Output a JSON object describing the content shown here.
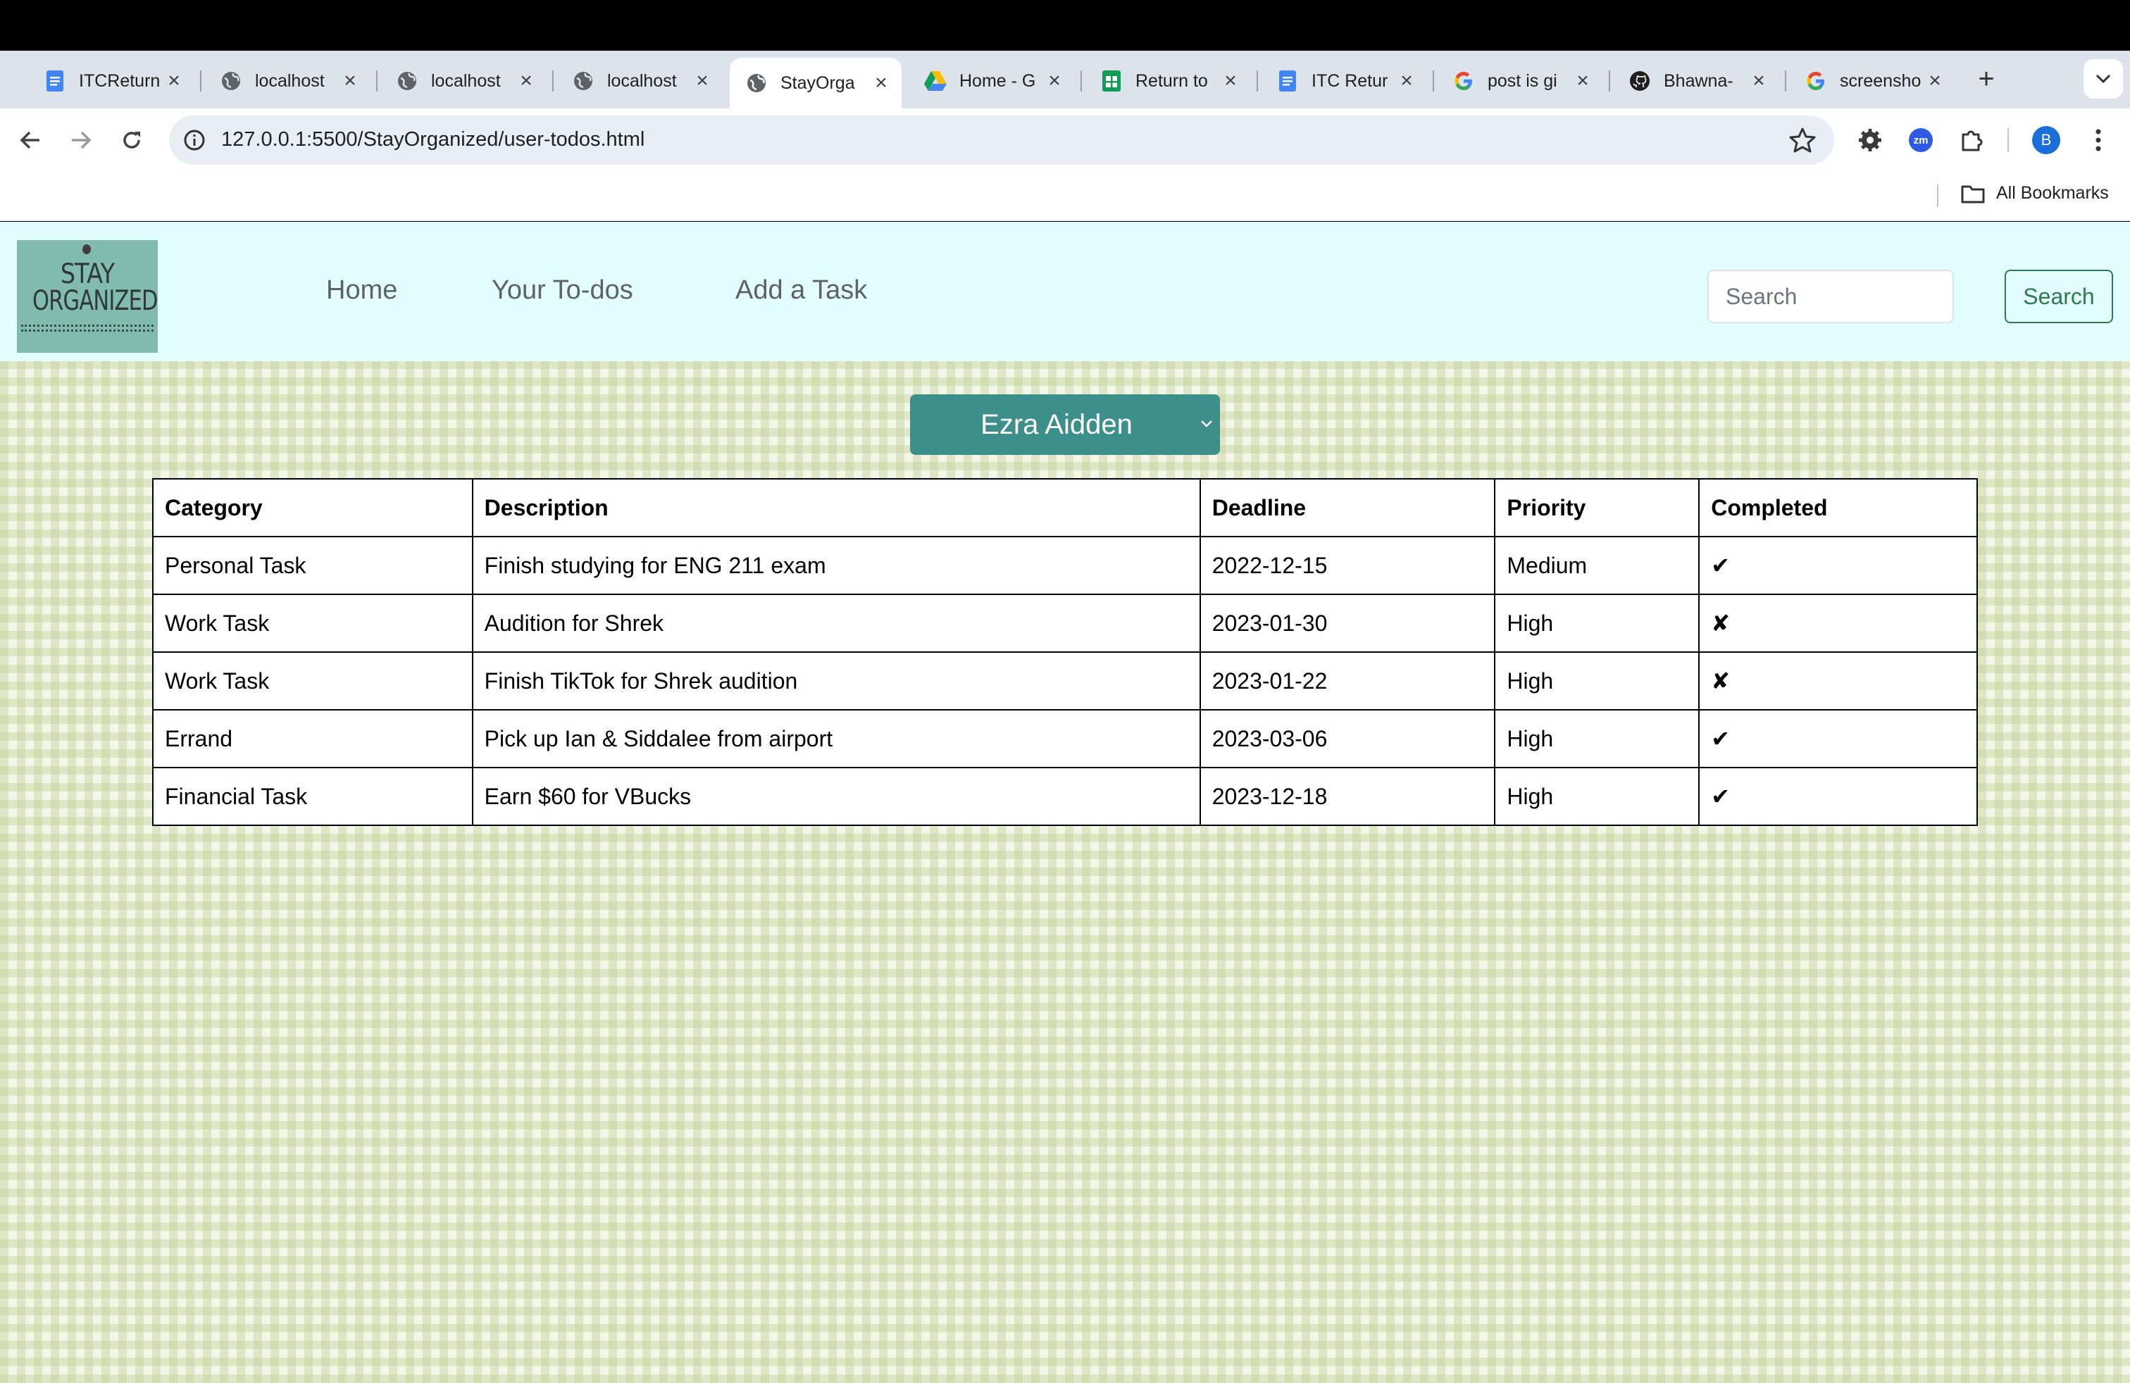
{
  "browser": {
    "tabs": [
      {
        "title": "ITCReturn",
        "icon": "google-docs-icon",
        "active": false
      },
      {
        "title": "localhost",
        "icon": "globe-icon",
        "active": false
      },
      {
        "title": "localhost",
        "icon": "globe-icon",
        "active": false
      },
      {
        "title": "localhost",
        "icon": "globe-icon",
        "active": false
      },
      {
        "title": "StayOrga",
        "icon": "globe-icon",
        "active": true
      },
      {
        "title": "Home - G",
        "icon": "google-drive-icon",
        "active": false
      },
      {
        "title": "Return to",
        "icon": "google-sheets-icon",
        "active": false
      },
      {
        "title": "ITC Retur",
        "icon": "google-docs-icon",
        "active": false
      },
      {
        "title": "post is gi",
        "icon": "google-icon",
        "active": false
      },
      {
        "title": "Bhawna-",
        "icon": "github-icon",
        "active": false
      },
      {
        "title": "screensho",
        "icon": "google-icon",
        "active": false
      }
    ],
    "url": "127.0.0.1:5500/StayOrganized/user-todos.html",
    "profile_initial": "B",
    "extension_label": "zm",
    "bookmarks_label": "All Bookmarks"
  },
  "site": {
    "logo": {
      "line1": "STAY",
      "line2": "ORGANIZED"
    },
    "nav": {
      "home": "Home",
      "todos": "Your To-dos",
      "add_task": "Add a Task"
    },
    "search": {
      "placeholder": "Search",
      "button": "Search"
    },
    "user_select": {
      "selected": "Ezra Aidden"
    },
    "colors": {
      "navbar_bg": "#e2fdfd",
      "select_bg": "#3c8f8a",
      "search_button": "#2f7a4f"
    }
  },
  "table": {
    "headers": [
      "Category",
      "Description",
      "Deadline",
      "Priority",
      "Completed"
    ],
    "rows": [
      [
        "Personal Task",
        "Finish studying for ENG 211 exam",
        "2022-12-15",
        "Medium",
        "✔"
      ],
      [
        "Work Task",
        "Audition for Shrek",
        "2023-01-30",
        "High",
        "✘"
      ],
      [
        "Work Task",
        "Finish TikTok for Shrek audition",
        "2023-01-22",
        "High",
        "✘"
      ],
      [
        "Errand",
        "Pick up Ian & Siddalee from airport",
        "2023-03-06",
        "High",
        "✔"
      ],
      [
        "Financial Task",
        "Earn $60 for VBucks",
        "2023-12-18",
        "High",
        "✔"
      ]
    ]
  }
}
